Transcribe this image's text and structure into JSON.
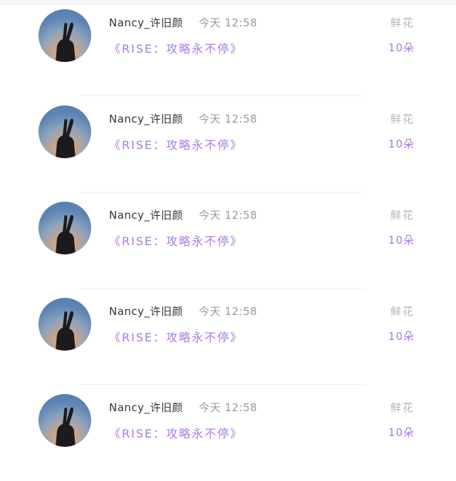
{
  "messages": [
    {
      "sender": "Nancy_许旧颜",
      "time": "今天 12:58",
      "text": "《RISE：攻略永不停》",
      "gift_label": "鲜花",
      "gift_count": "10朵"
    },
    {
      "sender": "Nancy_许旧颜",
      "time": "今天 12:58",
      "text": "《RISE：攻略永不停》",
      "gift_label": "鲜花",
      "gift_count": "10朵"
    },
    {
      "sender": "Nancy_许旧颜",
      "time": "今天 12:58",
      "text": "《RISE：攻略永不停》",
      "gift_label": "鲜花",
      "gift_count": "10朵"
    },
    {
      "sender": "Nancy_许旧颜",
      "time": "今天 12:58",
      "text": "《RISE：攻略永不停》",
      "gift_label": "鲜花",
      "gift_count": "10朵"
    },
    {
      "sender": "Nancy_许旧颜",
      "time": "今天 12:58",
      "text": "《RISE：攻略永不停》",
      "gift_label": "鲜花",
      "gift_count": "10朵"
    }
  ],
  "colors": {
    "accent_purple": "#a97ae0",
    "muted_gray": "#b5b5b5",
    "name_text": "#333333"
  },
  "icons": {
    "avatar": "peace-sign-hand-silhouette-at-dusk"
  }
}
